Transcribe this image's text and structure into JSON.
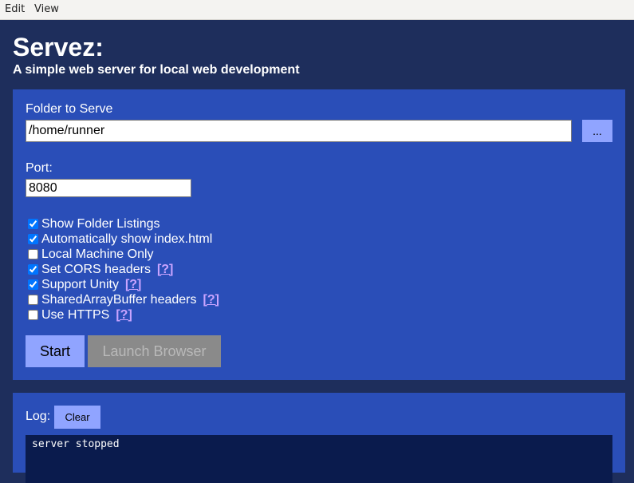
{
  "menubar": {
    "items": [
      {
        "label": "Edit"
      },
      {
        "label": "View"
      }
    ]
  },
  "header": {
    "title": "Servez:",
    "subtitle": "A simple web server for local web development"
  },
  "settings": {
    "folder_label": "Folder to Serve",
    "folder_value": "/home/runner",
    "browse_label": "...",
    "port_label": "Port:",
    "port_value": "8080",
    "options": [
      {
        "label": "Show Folder Listings",
        "checked": true,
        "help": ""
      },
      {
        "label": "Automatically show index.html",
        "checked": true,
        "help": ""
      },
      {
        "label": "Local Machine Only",
        "checked": false,
        "help": ""
      },
      {
        "label": "Set CORS headers",
        "checked": true,
        "help": "[?]"
      },
      {
        "label": "Support Unity",
        "checked": true,
        "help": "[?]"
      },
      {
        "label": "SharedArrayBuffer headers",
        "checked": false,
        "help": "[?]"
      },
      {
        "label": "Use HTTPS",
        "checked": false,
        "help": "[?]"
      }
    ],
    "start_label": "Start",
    "launch_label": "Launch Browser"
  },
  "log": {
    "label": "Log:",
    "clear_label": "Clear",
    "lines": [
      "server stopped"
    ]
  },
  "colors": {
    "background": "#1e2e5c",
    "panel": "#2a4eb8",
    "button": "#90a4ff",
    "button_disabled": "#8a8a8a",
    "help_link": "#c9a4ff",
    "log_background": "#0a1b4d"
  }
}
